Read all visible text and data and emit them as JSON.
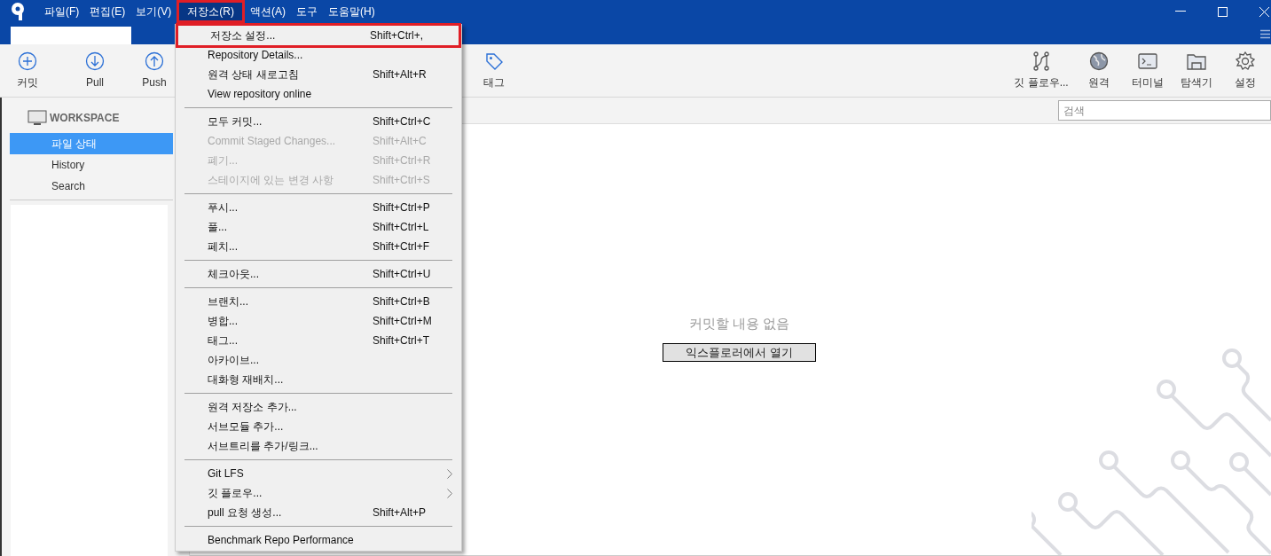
{
  "menu_bar": [
    {
      "label": "파일(F)",
      "selected": false
    },
    {
      "label": "편집(E)",
      "selected": false
    },
    {
      "label": "보기(V)",
      "selected": false
    },
    {
      "label": "저장소(R)",
      "selected": true,
      "highlighted": true
    },
    {
      "label": "액션(A)",
      "selected": false
    },
    {
      "label": "도구",
      "selected": false
    },
    {
      "label": "도움말(H)",
      "selected": false
    }
  ],
  "toolbar_left": [
    {
      "kind": "commit",
      "label": "커밋"
    },
    {
      "kind": "pull",
      "label": "Pull"
    },
    {
      "kind": "push",
      "label": "Push"
    }
  ],
  "toolbar_tag": {
    "kind": "tag",
    "label": "태그"
  },
  "toolbar_right": [
    {
      "kind": "gitflow",
      "label": "깃 플로우..."
    },
    {
      "kind": "remote",
      "label": "원격"
    },
    {
      "kind": "terminal",
      "label": "터미널"
    },
    {
      "kind": "explorer",
      "label": "탐색기"
    },
    {
      "kind": "settings",
      "label": "설정"
    }
  ],
  "sidebar": {
    "section": "WORKSPACE",
    "items": [
      {
        "label": "파일 상태",
        "selected": true
      },
      {
        "label": "History",
        "selected": false
      },
      {
        "label": "Search",
        "selected": false
      }
    ]
  },
  "search": {
    "placeholder": "검색"
  },
  "content": {
    "message": "커밋할 내용 없음",
    "button": "익스플로러에서 열기"
  },
  "menu": [
    {
      "kind": "item",
      "label": "저장소 설정...",
      "shortcut": "Shift+Ctrl+,",
      "disabled": false,
      "highlighted": true
    },
    {
      "kind": "item",
      "label": "Repository Details...",
      "disabled": false
    },
    {
      "kind": "item",
      "label": "원격 상태 새로고침",
      "shortcut": "Shift+Alt+R",
      "disabled": false
    },
    {
      "kind": "item",
      "label": "View repository online",
      "disabled": false
    },
    {
      "kind": "separator"
    },
    {
      "kind": "item",
      "label": "모두 커밋...",
      "shortcut": "Shift+Ctrl+C",
      "disabled": false
    },
    {
      "kind": "item",
      "label": "Commit Staged Changes...",
      "shortcut": "Shift+Alt+C",
      "disabled": true
    },
    {
      "kind": "item",
      "label": "폐기...",
      "shortcut": "Shift+Ctrl+R",
      "disabled": true
    },
    {
      "kind": "item",
      "label": "스테이지에 있는 변경 사항",
      "shortcut": "Shift+Ctrl+S",
      "disabled": true
    },
    {
      "kind": "separator"
    },
    {
      "kind": "item",
      "label": "푸시...",
      "shortcut": "Shift+Ctrl+P",
      "disabled": false
    },
    {
      "kind": "item",
      "label": "풀...",
      "shortcut": "Shift+Ctrl+L",
      "disabled": false
    },
    {
      "kind": "item",
      "label": "페치...",
      "shortcut": "Shift+Ctrl+F",
      "disabled": false
    },
    {
      "kind": "separator"
    },
    {
      "kind": "item",
      "label": "체크아웃...",
      "shortcut": "Shift+Ctrl+U",
      "disabled": false
    },
    {
      "kind": "separator"
    },
    {
      "kind": "item",
      "label": "브랜치...",
      "shortcut": "Shift+Ctrl+B",
      "disabled": false
    },
    {
      "kind": "item",
      "label": "병합...",
      "shortcut": "Shift+Ctrl+M",
      "disabled": false
    },
    {
      "kind": "item",
      "label": "태그...",
      "shortcut": "Shift+Ctrl+T",
      "disabled": false
    },
    {
      "kind": "item",
      "label": "아카이브...",
      "disabled": false
    },
    {
      "kind": "item",
      "label": "대화형 재배치...",
      "disabled": false
    },
    {
      "kind": "separator"
    },
    {
      "kind": "item",
      "label": "원격 저장소 추가...",
      "disabled": false
    },
    {
      "kind": "item",
      "label": "서브모듈 추가...",
      "disabled": false
    },
    {
      "kind": "item",
      "label": "서브트리를 추가/링크...",
      "disabled": false
    },
    {
      "kind": "separator"
    },
    {
      "kind": "item",
      "label": "Git LFS",
      "disabled": false,
      "submenu": true
    },
    {
      "kind": "item",
      "label": "깃 플로우...",
      "disabled": false,
      "submenu": true
    },
    {
      "kind": "item",
      "label": "pull 요청 생성...",
      "shortcut": "Shift+Alt+P",
      "disabled": false
    },
    {
      "kind": "separator"
    },
    {
      "kind": "item",
      "label": "Benchmark Repo Performance",
      "disabled": false
    }
  ]
}
